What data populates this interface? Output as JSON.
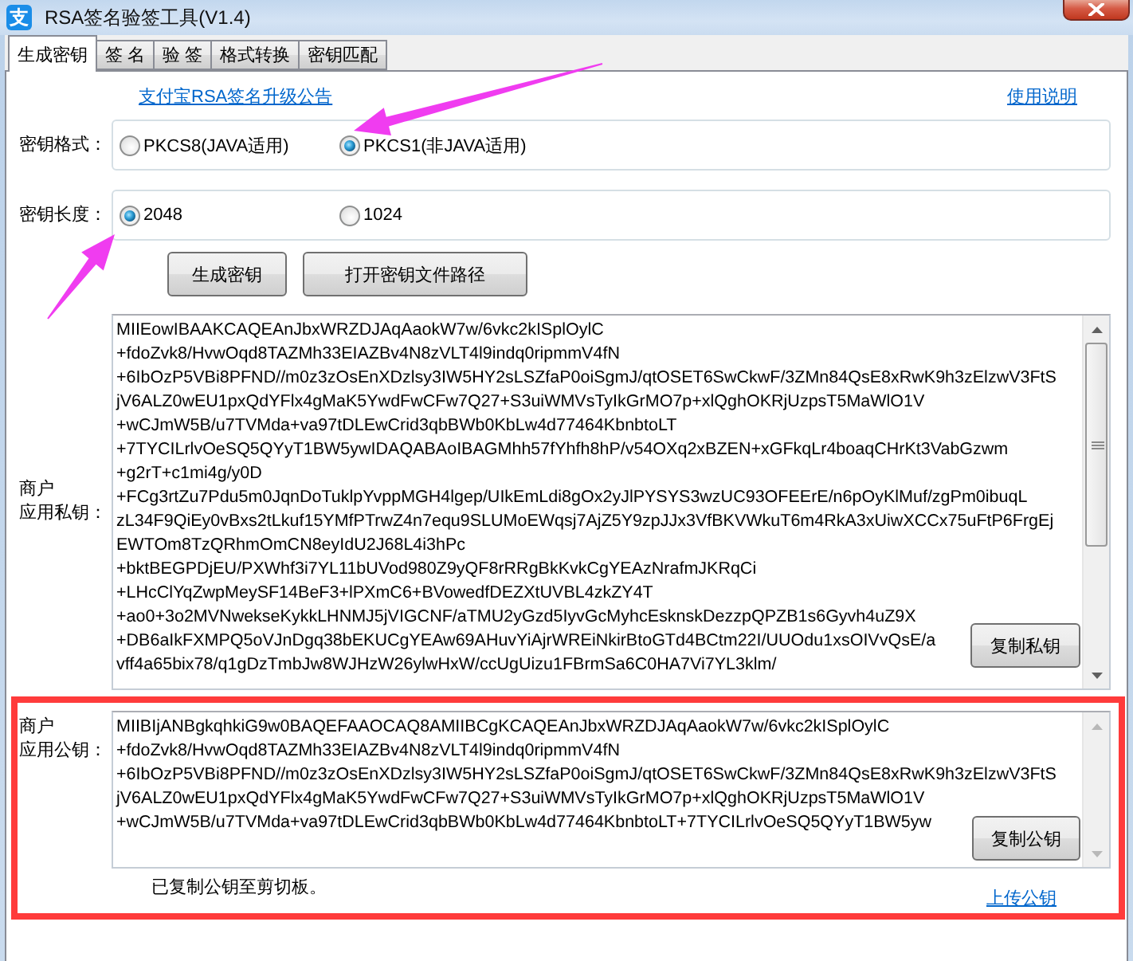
{
  "window": {
    "logo_text": "支",
    "title": "RSA签名验签工具(V1.4)"
  },
  "tabs": [
    {
      "label": "生成密钥",
      "selected": true
    },
    {
      "label": "签 名",
      "selected": false
    },
    {
      "label": "验 签",
      "selected": false
    },
    {
      "label": "格式转换",
      "selected": false
    },
    {
      "label": "密钥匹配",
      "selected": false
    }
  ],
  "announcement_link": "支付宝RSA签名升级公告",
  "help_link": "使用说明",
  "key_format": {
    "label": "密钥格式：",
    "options": [
      {
        "label": "PKCS8(JAVA适用)",
        "selected": false
      },
      {
        "label": "PKCS1(非JAVA适用)",
        "selected": true
      }
    ]
  },
  "key_length": {
    "label": "密钥长度：",
    "options": [
      {
        "label": "2048",
        "selected": true
      },
      {
        "label": "1024",
        "selected": false
      }
    ]
  },
  "buttons": [
    "生成密钥",
    "打开密钥文件路径"
  ],
  "private_key": {
    "label_lines": [
      "商户",
      "应用私钥："
    ],
    "lines": [
      "MIIEowIBAAKCAQEAnJbxWRZDJAqAaokW7w/6vkc2kISplOylC",
      "+fdoZvk8/HvwOqd8TAZMh33EIAZBv4N8zVLT4l9indq0ripmmV4fN",
      "+6IbOzP5VBi8PFND//m0z3zOsEnXDzlsy3IW5HY2sLSZfaP0oiSgmJ/qtOSET6SwCkwF/3ZMn84QsE8xRwK9h3zElzwV3FtS",
      "jV6ALZ0wEU1pxQdYFlx4gMaK5YwdFwCFw7Q27+S3uiWMVsTyIkGrMO7p+xlQghOKRjUzpsT5MaWlO1V",
      "+wCJmW5B/u7TVMda+va97tDLEwCrid3qbBWb0KbLw4d77464KbnbtoLT",
      "+7TYCILrlvOeSQ5QYyT1BW5ywIDAQABAoIBAGMhh57fYhfh8hP/v54OXq2xBZEN+xGFkqLr4boaqCHrKt3VabGzwm",
      "+g2rT+c1mi4g/y0D",
      "+FCg3rtZu7Pdu5m0JqnDoTuklpYvppMGH4lgep/UIkEmLdi8gOx2yJlPYSYS3wzUC93OFEErE/n6pOyKlMuf/zgPm0ibuqL",
      "zL34F9QiEy0vBxs2tLkuf15YMfPTrwZ4n7equ9SLUMoEWqsj7AjZ5Y9zpJJx3VfBKVWkuT6m4RkA3xUiwXCCx75uFtP6FrgEj",
      "EWTOm8TzQRhmOmCN8eyIdU2J68L4i3hPc",
      "+bktBEGPDjEU/PXWhf3i7YL11bUVod980Z9yQF8rRRgBkKvkCgYEAzNrafmJKRqCi",
      "+LHcClYqZwpMeySF14BeF3+lPXmC6+BVowedfDEZXtUVBL4zkZY4T",
      "+ao0+3o2MVNwekseKykkLHNMJ5jVIGCNF/aTMU2yGzd5IyvGcMyhcEsknskDezzpQPZB1s6Gyvh4uZ9X",
      "+DB6aIkFXMPQ5oVJnDgq38bEKUCgYEAw69AHuvYiAjrWREiNkirBtoGTd4BCtm22I/UUOdu1xsOIVvQsE/a",
      "vff4a65bix78/q1gDzTmbJw8WJHzW26ylwHxW/ccUgUizu1FBrmSa6C0HA7Vi7YL3klm/"
    ],
    "copy_button": "复制私钥"
  },
  "public_key": {
    "highlighted": true,
    "label_lines": [
      "商户",
      "应用公钥："
    ],
    "lines": [
      "MIIBIjANBgkqhkiG9w0BAQEFAAOCAQ8AMIIBCgKCAQEAnJbxWRZDJAqAaokW7w/6vkc2kISplOylC",
      "+fdoZvk8/HvwOqd8TAZMh33EIAZBv4N8zVLT4l9indq0ripmmV4fN",
      "+6IbOzP5VBi8PFND//m0z3zOsEnXDzlsy3IW5HY2sLSZfaP0oiSgmJ/qtOSET6SwCkwF/3ZMn84QsE8xRwK9h3zElzwV3FtS",
      "jV6ALZ0wEU1pxQdYFlx4gMaK5YwdFwCFw7Q27+S3uiWMVsTyIkGrMO7p+xlQghOKRjUzpsT5MaWlO1V",
      "+wCJmW5B/u7TVMda+va97tDLEwCrid3qbBWb0KbLw4d77464KbnbtoLT+7TYCILrlvOeSQ5QYyT1BW5yw"
    ],
    "copy_button": "复制公钥",
    "status": "已复制公钥至剪切板。",
    "upload_link": "上传公钥"
  }
}
